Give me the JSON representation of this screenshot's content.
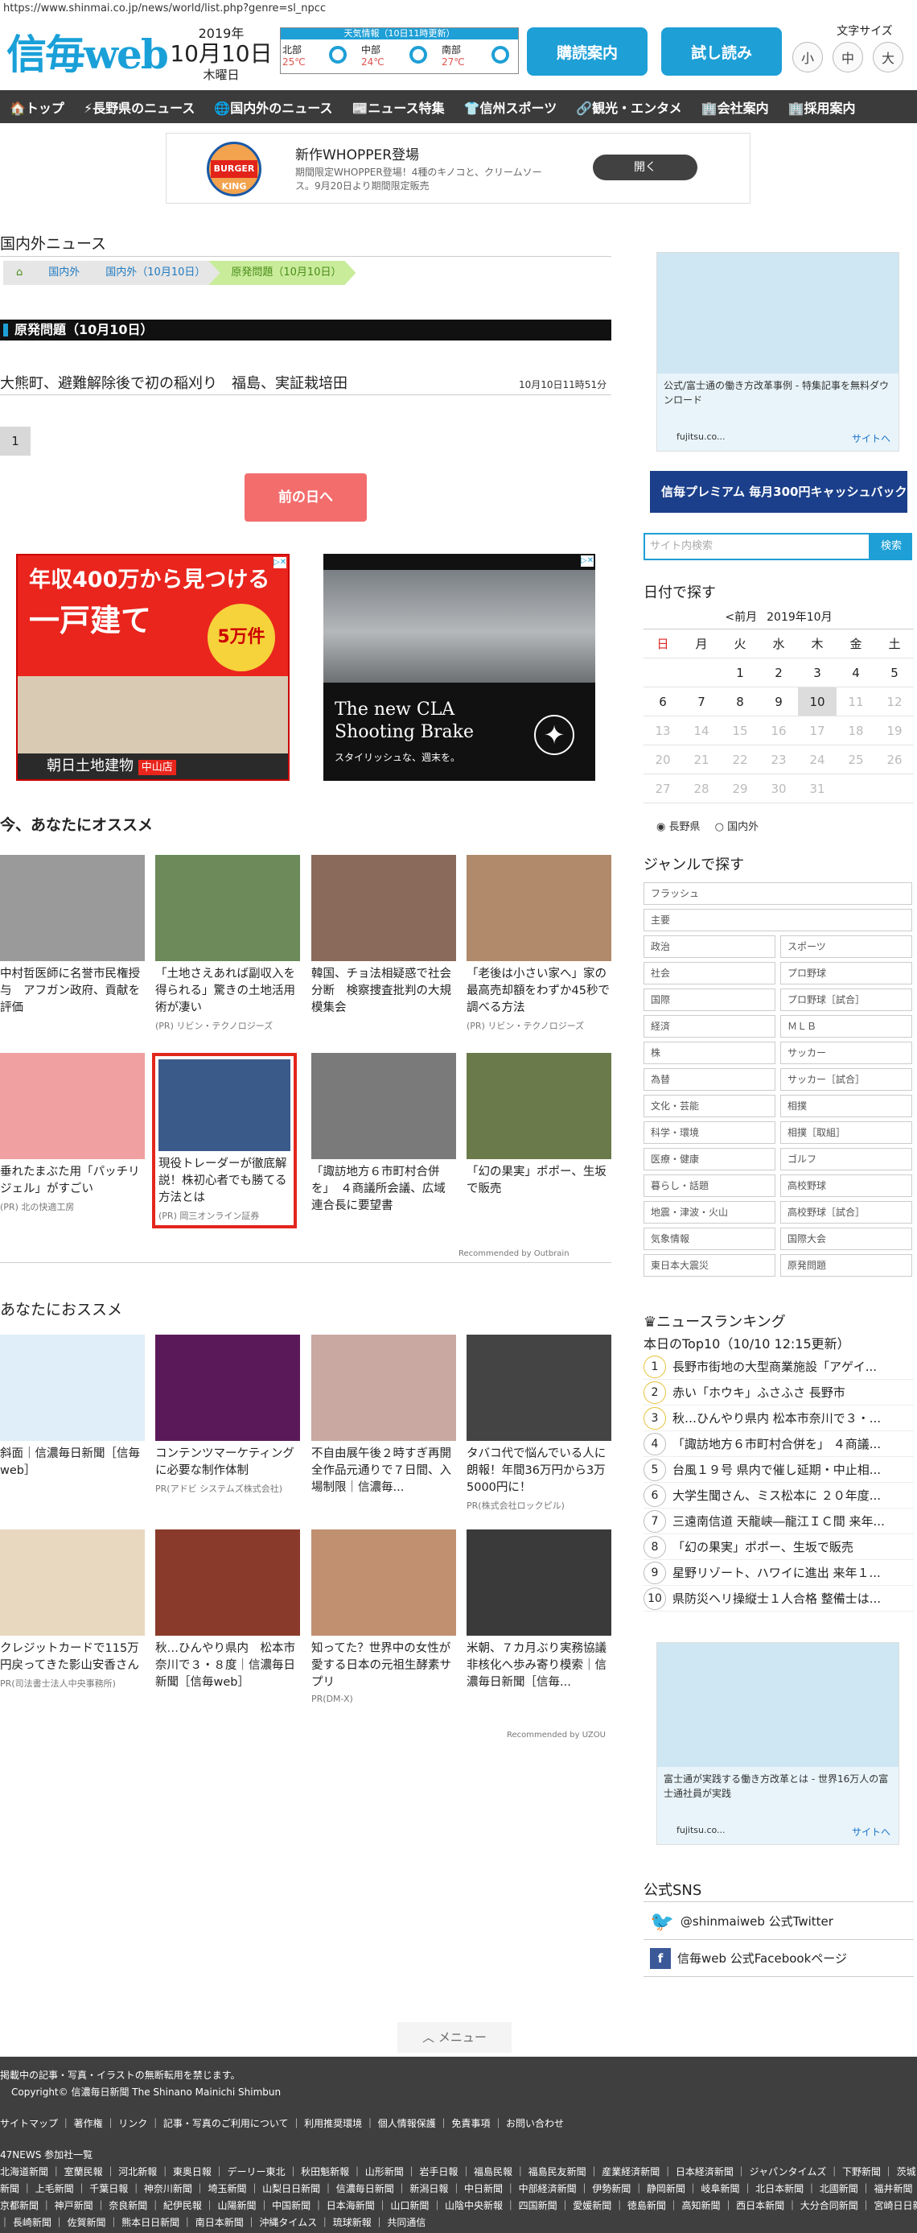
{
  "browser": {
    "url": "https://www.shinmai.co.jp/news/world/list.php?genre=sl_npcc"
  },
  "header": {
    "logo": "信毎web",
    "year": "2019年",
    "day": "10月10日",
    "weekday": "木曜日",
    "weather_title": "天気情報（10日11時更新）",
    "weather": [
      {
        "area": "北部",
        "temp": "25℃"
      },
      {
        "area": "中部",
        "temp": "24℃"
      },
      {
        "area": "南部",
        "temp": "27℃"
      }
    ],
    "btn_delivery": "購読案内",
    "btn_trial": "試し読み",
    "font_size_label": "文字サイズ",
    "font_small": "小",
    "font_mid": "中",
    "font_large": "大"
  },
  "nav": [
    "🏠トップ",
    "⚡長野県のニュース",
    "🌐国内外のニュース",
    "📰ニュース特集",
    "👕信州スポーツ",
    "🔗観光・エンタメ",
    "🏢会社案内",
    "🏢採用案内"
  ],
  "banner_ad": {
    "title": "新作WHOPPER登場",
    "text": "期間限定WHOPPER登場！4種のキノコと、クリームソース。9月20日より期間限定販売",
    "open": "開く",
    "brand": "BURGER KING"
  },
  "page": {
    "section_title": "国内外ニュース",
    "breadcrumb": [
      "国内外",
      "国内外（10月10日）",
      "原発問題（10月10日）"
    ],
    "category_title": "原発問題（10月10日）",
    "article_title": "大熊町、避難解除後で初の稲刈り　福島、実証栽培田",
    "article_date": "10月10日11時51分",
    "page_num": "1",
    "prev_day": "前の日へ"
  },
  "ads": {
    "left_line1": "年収400万から見つける",
    "left_line2": "一戸建て",
    "left_badge": "5万件",
    "left_company": "朝日土地建物",
    "left_store": "中山店",
    "right_line1": "The new CLA",
    "right_line2": "Shooting Brake",
    "right_sub": "スタイリッシュな、週末を。"
  },
  "recommend1": {
    "title": "今、あなたにオススメ",
    "cards": [
      {
        "title": "中村哲医師に名誉市民権授与　アフガン政府、貢献を評価",
        "pr": ""
      },
      {
        "title": "「土地さえあれば副収入を得られる」驚きの土地活用術が凄い",
        "pr": "(PR) リビン・テクノロジーズ"
      },
      {
        "title": "韓国、チョ法相疑惑で社会分断　検察捜査批判の大規模集会",
        "pr": ""
      },
      {
        "title": "「老後は小さい家へ」家の最高売却額をわずか45秒で調べる方法",
        "pr": "(PR) リビン・テクノロジーズ"
      },
      {
        "title": "垂れたまぶた用「パッチリジェル」がすごい",
        "pr": "(PR) 北の快適工房"
      },
      {
        "title": "現役トレーダーが徹底解説！株初心者でも勝てる方法とは",
        "pr": "(PR) 岡三オンライン証券"
      },
      {
        "title": "「諏訪地方６市町村合併を」　４商議所会議、広域連合長に要望書",
        "pr": ""
      },
      {
        "title": "「幻の果実」ポポー、生坂で販売",
        "pr": ""
      }
    ],
    "powered": "Recommended by Outbrain"
  },
  "recommend2": {
    "title": "あなたにおススメ",
    "cards": [
      {
        "title": "斜面｜信濃毎日新聞［信毎web］",
        "pr": ""
      },
      {
        "title": "コンテンツマーケティングに必要な制作体制",
        "pr": "PR(アドビ システムズ株式会社)"
      },
      {
        "title": "不自由展午後２時すぎ再開全作品元通りで７日間、入場制限｜信濃毎...",
        "pr": ""
      },
      {
        "title": "タバコ代で悩んでいる人に朗報！年間36万円から3万5000円に！",
        "pr": "PR(株式会社ロックピル)"
      },
      {
        "title": "クレジットカードで115万円戻ってきた影山安香さん",
        "pr": "PR(司法書士法人中央事務所)"
      },
      {
        "title": "秋…ひんやり県内　松本市奈川で３・８度｜信濃毎日新聞［信毎web］",
        "pr": ""
      },
      {
        "title": "知ってた？世界中の女性が愛する日本の元祖生酵素サプリ",
        "pr": "PR(DM-X)"
      },
      {
        "title": "米朝、７カ月ぶり実務協議非核化へ歩み寄り模索｜信濃毎日新聞［信毎...",
        "pr": ""
      }
    ],
    "powered": "Recommended by UZOU"
  },
  "sidebar": {
    "ad1_text": "公式/富士通の働き方改革事例 - 特集記事を無料ダウンロード",
    "ad1_src": "fujitsu.co...",
    "ad1_link": "サイトへ",
    "premium_text": "信毎プレミアム 毎月300円キャッシュバック!",
    "search_placeholder": "サイト内検索",
    "search_btn": "検索",
    "date_title": "日付で探す",
    "cal_prev": "<前月",
    "cal_month": "2019年10月",
    "cal_head": [
      "日",
      "月",
      "火",
      "水",
      "木",
      "金",
      "土"
    ],
    "cal_rows": [
      [
        "",
        "",
        "1",
        "2",
        "3",
        "4",
        "5"
      ],
      [
        "6",
        "7",
        "8",
        "9",
        "10",
        "11",
        "12"
      ],
      [
        "13",
        "14",
        "15",
        "16",
        "17",
        "18",
        "19"
      ],
      [
        "20",
        "21",
        "22",
        "23",
        "24",
        "25",
        "26"
      ],
      [
        "27",
        "28",
        "29",
        "30",
        "31",
        "",
        ""
      ]
    ],
    "radio1": "長野県",
    "radio2": "国内外",
    "genre_title": "ジャンルで探す",
    "genres_full": [
      "フラッシュ",
      "主要"
    ],
    "genres": [
      "政治",
      "スポーツ",
      "社会",
      "プロ野球",
      "国際",
      "プロ野球［試合］",
      "経済",
      "ＭＬＢ",
      "株",
      "サッカー",
      "為替",
      "サッカー［試合］",
      "文化・芸能",
      "相撲",
      "科学・環境",
      "相撲［取組］",
      "医療・健康",
      "ゴルフ",
      "暮らし・話題",
      "高校野球",
      "地震・津波・火山",
      "高校野球［試合］",
      "気象情報",
      "国際大会",
      "東日本大震災",
      "原発問題"
    ],
    "rank_title": "ニュースランキング",
    "rank_sub": "本日のTop10（10/10 12:15更新）",
    "ranking": [
      "長野市街地の大型商業施設「アゲイ...",
      "赤い「ホウキ」ふさふさ 長野市",
      "秋…ひんやり県内 松本市奈川で３・...",
      "「諏訪地方６市町村合併を」 ４商議...",
      "台風１９号 県内で催し延期・中止相...",
      "大学生聞さん、ミス松本に ２０年度...",
      "三遠南信道 天龍峡―龍江ＩＣ間 来年...",
      "「幻の果実」ポポー、生坂で販売",
      "星野リゾート、ハワイに進出 来年１...",
      "県防災ヘリ操縦士１人合格 整備士は..."
    ],
    "ad2_text": "富士通が実践する働き方改革とは - 世界16万人の富士通社員が実践",
    "ad2_src": "fujitsu.co...",
    "ad2_link": "サイトへ",
    "sns_title": "公式SNS",
    "sns_twitter": "@shinmaiweb 公式Twitter",
    "sns_facebook": "信毎web 公式Facebookページ"
  },
  "footer": {
    "menu": "メニュー",
    "notice": "掲載中の記事・写真・イラストの無断転用を禁じます。",
    "copyright": "Copyright© 信濃毎日新聞 The Shinano Mainichi Shimbun",
    "links": "サイトマップ ｜ 著作権 ｜ リンク ｜ 記事・写真のご利用について ｜ 利用推奨環境 ｜ 個人情報保護 ｜ 免責事項 ｜ お問い合わせ",
    "group_title": "47NEWS 参加社一覧",
    "group1": "北海道新聞 ｜ 室蘭民報 ｜ 河北新報 ｜ 東奥日報 ｜ デーリー東北 ｜ 秋田魁新報 ｜ 山形新聞 ｜ 岩手日報 ｜ 福島民報 ｜ 福島民友新聞 ｜ 産業経済新聞 ｜ 日本経済新聞 ｜ ジャパンタイムズ ｜ 下野新聞 ｜ 茨城",
    "group2": "新聞 ｜ 上毛新聞 ｜ 千葉日報 ｜ 神奈川新聞 ｜ 埼玉新聞 ｜ 山梨日日新聞 ｜ 信濃毎日新聞 ｜ 新潟日報 ｜ 中日新聞 ｜ 中部経済新聞 ｜ 伊勢新聞 ｜ 静岡新聞 ｜ 岐阜新聞 ｜ 北日本新聞 ｜ 北國新聞 ｜ 福井新聞 ｜",
    "group3": "京都新聞 ｜ 神戸新聞 ｜ 奈良新聞 ｜ 紀伊民報 ｜ 山陽新聞 ｜ 中国新聞 ｜ 日本海新聞 ｜ 山口新聞 ｜ 山陰中央新報 ｜ 四国新聞 ｜ 愛媛新聞 ｜ 徳島新聞 ｜ 高知新聞 ｜ 西日本新聞 ｜ 大分合同新聞 ｜ 宮崎日日新聞",
    "group4": "｜ 長崎新聞 ｜ 佐賀新聞 ｜ 熊本日日新聞 ｜ 南日本新聞 ｜ 沖縄タイムス ｜ 琉球新報 ｜ 共同通信"
  }
}
